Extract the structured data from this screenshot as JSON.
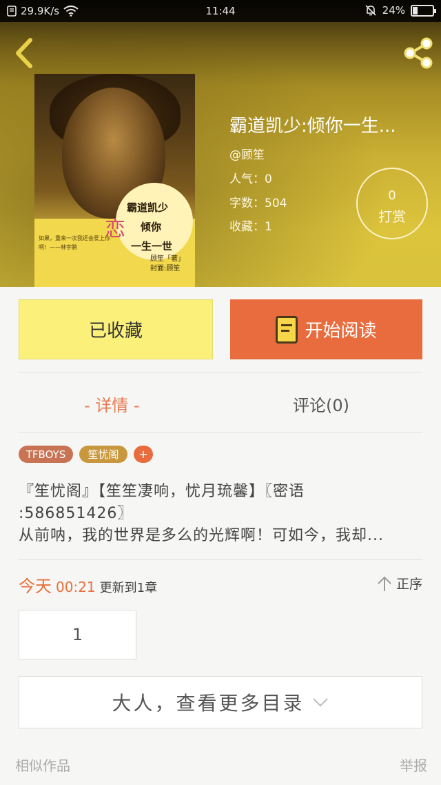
{
  "status_bar": {
    "net_speed": "29.9K/s",
    "time": "11:44",
    "battery": "24%",
    "battery_level": 0.24
  },
  "book": {
    "title": "霸道凯少:倾你一生...",
    "author": "@顾笙",
    "popularity": "人气：0",
    "word_count": "字数：504",
    "favorites": "收藏：1",
    "tip_count": "0",
    "tip_label": "打赏",
    "cover": {
      "title_lines": [
        "霸道凯少",
        "倾你",
        "一生一世"
      ],
      "love_char": "恋",
      "quote": "如果，重来一次我还会爱上你啊！——林宇鹏",
      "credit_lines": [
        "顾笙「著」",
        "封面:顾笙"
      ]
    }
  },
  "actions": {
    "favorited_label": "已收藏",
    "read_label": "开始阅读"
  },
  "tabs": {
    "detail": "- 详情 -",
    "comments": "评论(0)"
  },
  "tags": [
    "TFBOYS",
    "笙忧阁",
    "+"
  ],
  "description": {
    "line1": "『笙忧阁』【笙笙凄响，忧月琉馨】〖密语",
    "line2": ":586851426〗",
    "line3": "从前呐，我的世界是多么的光辉啊！可如今，我却..."
  },
  "update": {
    "day": "今天",
    "time": "00:21",
    "text": "更新到1章",
    "sort_label": "正序"
  },
  "chapters": [
    "1"
  ],
  "more_catalog": "大人，查看更多目录",
  "footer": {
    "similar": "相似作品",
    "report": "举报"
  },
  "colors": {
    "accent": "#e86c3e",
    "favorite_bg": "#fbf17a",
    "tag_tfboys": "#c97355",
    "tag_group": "#c9983e"
  }
}
